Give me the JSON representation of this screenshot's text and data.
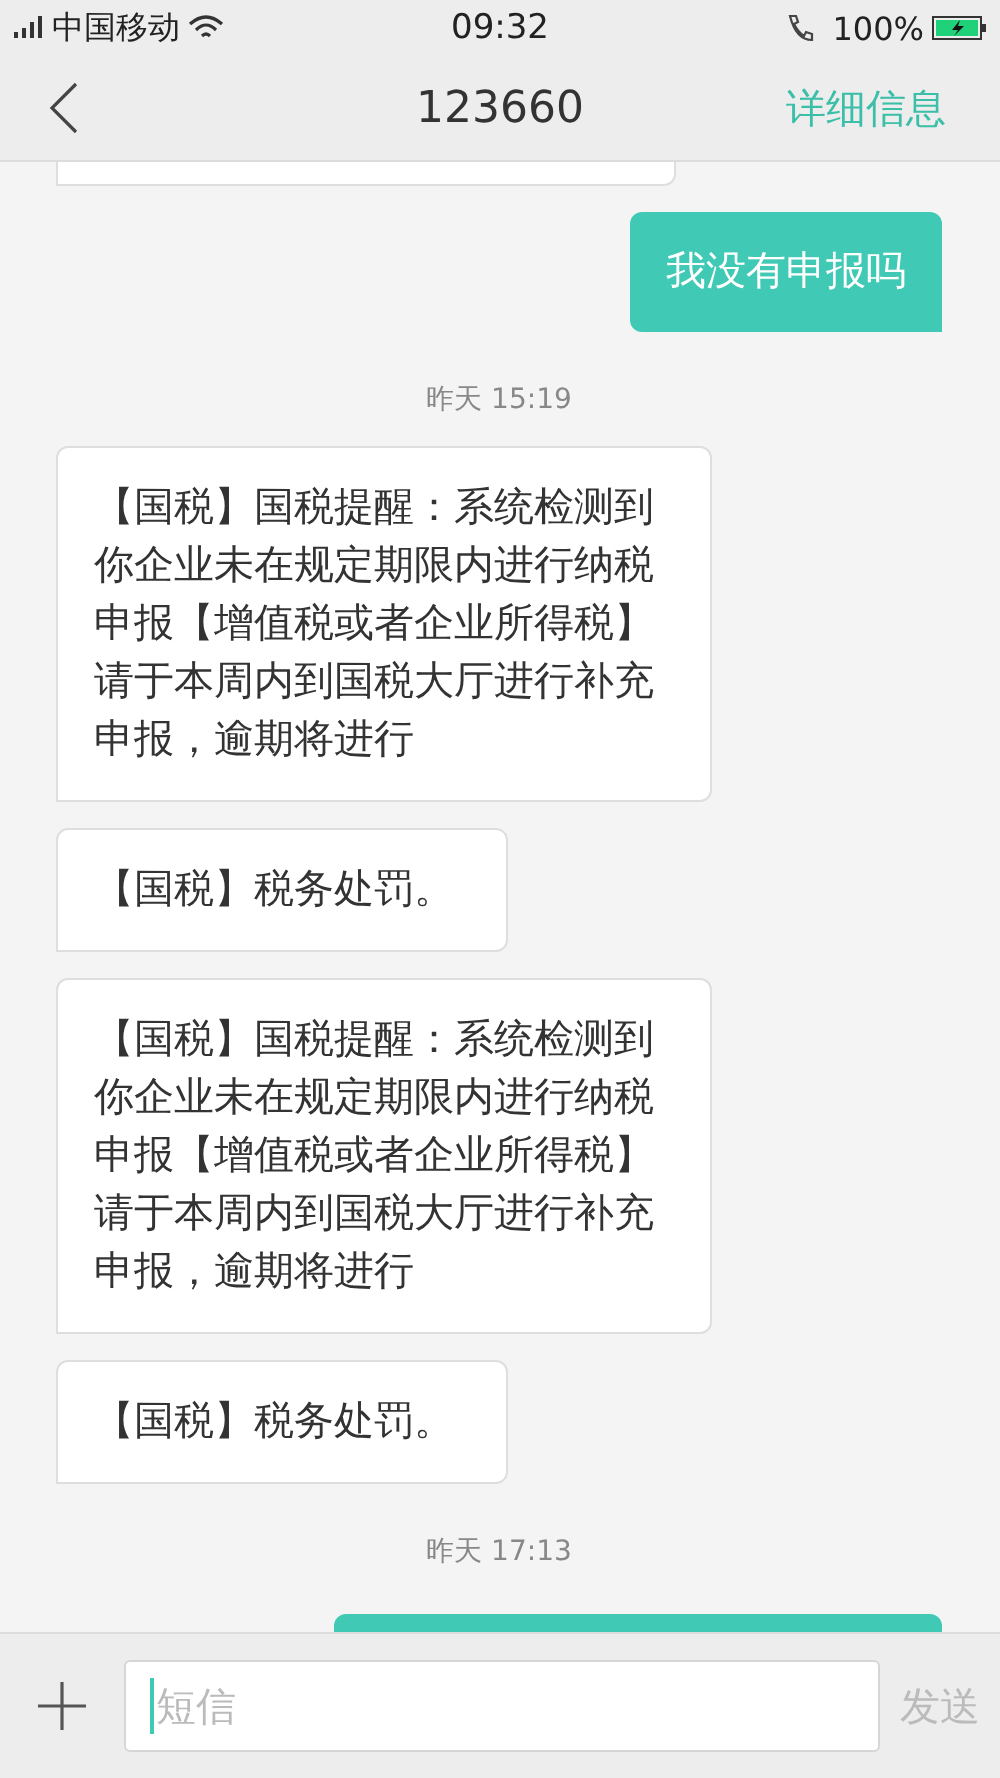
{
  "status_bar": {
    "carrier": "中国移动",
    "time": "09:32",
    "battery": "100%",
    "charging": true
  },
  "header": {
    "title": "123660",
    "action": "详细信息"
  },
  "messages": [
    {
      "kind": "received_cut_top"
    },
    {
      "kind": "sent",
      "text": "我没有申报吗"
    },
    {
      "kind": "time",
      "text": "昨天  15:19"
    },
    {
      "kind": "received",
      "text": "【国税】国税提醒：系统检测到你企业未在规定期限内进行纳税申报【增值税或者企业所得税】请于本周内到国税大厅进行补充申报，逾期将进行"
    },
    {
      "kind": "received",
      "text": "【国税】税务处罚。"
    },
    {
      "kind": "received",
      "text": "【国税】国税提醒：系统检测到你企业未在规定期限内进行纳税申报【增值税或者企业所得税】请于本周内到国税大厅进行补充申报，逾期将进行"
    },
    {
      "kind": "received",
      "text": "【国税】税务处罚。"
    },
    {
      "kind": "time",
      "text": "昨天  17:13"
    },
    {
      "kind": "sent_cut_bottom"
    }
  ],
  "composer": {
    "placeholder": "短信",
    "send": "发送"
  }
}
